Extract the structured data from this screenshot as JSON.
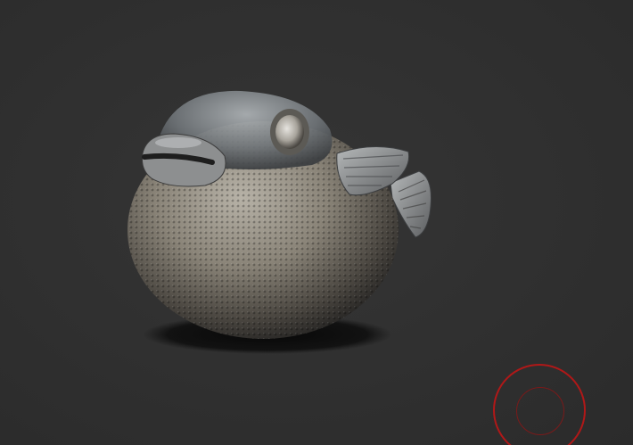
{
  "viewport": {
    "model": "pufferfish-sculpt",
    "background_color": "#303030",
    "material_color": "#8a8478"
  },
  "brush_cursor": {
    "outer_color": "#b01818",
    "inner_color": "#7a1a1a"
  }
}
